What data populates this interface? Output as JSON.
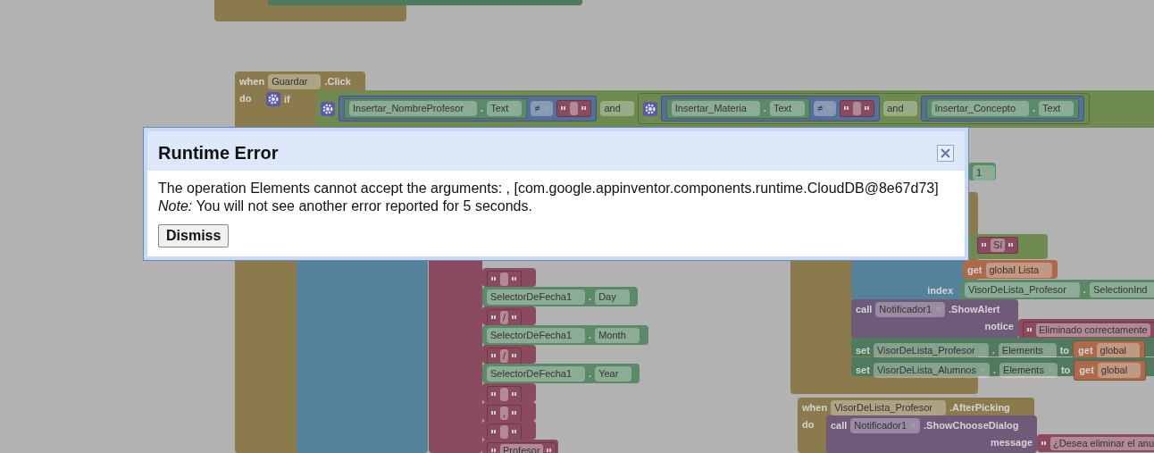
{
  "workspace": {
    "blocks": [
      {
        "color": "#8b7b4c"
      },
      {
        "color": "#4f7a5e"
      },
      {
        "color": "#8b7b4c",
        "lines": [
          [
            {
              "kind": "label",
              "text": "when"
            },
            {
              "kind": "dropdown",
              "text": "Guardar"
            },
            {
              "kind": "label",
              "text": ".Click"
            }
          ],
          [
            {
              "kind": "label",
              "text": "do"
            }
          ]
        ]
      },
      {
        "color": "#8b7b4c",
        "lines": [
          [
            {
              "kind": "gear"
            },
            {
              "kind": "label",
              "text": "if"
            }
          ]
        ]
      },
      {
        "color": "#56819b"
      },
      {
        "color": "#8a4a5f"
      },
      {
        "color": "#6e8a50",
        "lines": [
          [
            {
              "kind": "gear"
            },
            {
              "kind": "block",
              "color": "#566f97",
              "parts": [
                {
                  "kind": "block",
                  "color": "#5b8a68",
                  "parts": [
                    {
                      "kind": "dropdown",
                      "text": "Insertar_NombreProfesor"
                    },
                    {
                      "kind": "label",
                      "text": "."
                    },
                    {
                      "kind": "dropdown",
                      "text": "Text"
                    }
                  ]
                },
                {
                  "kind": "dropdown",
                  "text": "≠"
                },
                {
                  "kind": "empty"
                }
              ]
            },
            {
              "kind": "dropdown",
              "text": "and"
            },
            {
              "kind": "block",
              "parts": [
                {
                  "kind": "gear"
                },
                {
                  "kind": "block",
                  "color": "#566f97",
                  "parts": [
                    {
                      "kind": "block",
                      "color": "#5b8a68",
                      "parts": [
                        {
                          "kind": "dropdown",
                          "text": "Insertar_Materia"
                        },
                        {
                          "kind": "label",
                          "text": "."
                        },
                        {
                          "kind": "dropdown",
                          "text": "Text"
                        }
                      ]
                    },
                    {
                      "kind": "dropdown",
                      "text": "≠"
                    },
                    {
                      "kind": "empty"
                    }
                  ]
                },
                {
                  "kind": "dropdown",
                  "text": "and"
                },
                {
                  "kind": "block",
                  "color": "#566f97",
                  "parts": [
                    {
                      "kind": "block",
                      "color": "#5b8a68",
                      "parts": [
                        {
                          "kind": "dropdown",
                          "text": "Insertar_Concepto"
                        },
                        {
                          "kind": "label",
                          "text": "."
                        },
                        {
                          "kind": "dropdown",
                          "text": "Text"
                        }
                      ]
                    }
                  ]
                }
              ]
            }
          ]
        ]
      },
      {
        "color": "#8a4a5f",
        "lines": [
          [
            {
              "kind": "empty"
            }
          ]
        ]
      },
      {
        "color": "#5b8a68",
        "lines": [
          [
            {
              "kind": "dropdown",
              "text": "SelectorDeFecha1"
            },
            {
              "kind": "label",
              "text": "."
            },
            {
              "kind": "dropdown",
              "text": "Day"
            }
          ]
        ]
      },
      {
        "color": "#8a4a5f",
        "lines": [
          [
            {
              "kind": "string",
              "text": "/"
            }
          ]
        ]
      },
      {
        "color": "#5b8a68",
        "lines": [
          [
            {
              "kind": "dropdown",
              "text": "SelectorDeFecha1"
            },
            {
              "kind": "label",
              "text": "."
            },
            {
              "kind": "dropdown",
              "text": "Month"
            }
          ]
        ]
      },
      {
        "color": "#8a4a5f",
        "lines": [
          [
            {
              "kind": "string",
              "text": "/"
            }
          ]
        ]
      },
      {
        "color": "#5b8a68",
        "lines": [
          [
            {
              "kind": "dropdown",
              "text": "SelectorDeFecha1"
            },
            {
              "kind": "label",
              "text": "."
            },
            {
              "kind": "dropdown",
              "text": "Year"
            }
          ]
        ]
      },
      {
        "color": "#8a4a5f",
        "lines": [
          [
            {
              "kind": "empty"
            }
          ]
        ]
      },
      {
        "color": "#8a4a5f",
        "lines": [
          [
            {
              "kind": "string",
              "text": ","
            }
          ]
        ]
      },
      {
        "color": "#8a4a5f",
        "lines": [
          [
            {
              "kind": "empty"
            }
          ]
        ]
      },
      {
        "color": "#8a4a5f",
        "lines": [
          [
            {
              "kind": "string",
              "text": "Profesor"
            }
          ]
        ]
      },
      {
        "color": "#8b7b4c"
      },
      {
        "color": "#5b8a68",
        "lines": [
          [
            {
              "kind": "dropdown",
              "text": "1"
            }
          ]
        ]
      },
      {
        "color": "#6e8a50",
        "lines": [
          [
            {
              "kind": "string",
              "text": "Sí"
            }
          ]
        ]
      },
      {
        "color": "#56819b",
        "lines": [
          [
            {
              "kind": "label",
              "text": "index"
            }
          ]
        ]
      },
      {
        "color": "#ad6a4b",
        "lines": [
          [
            {
              "kind": "label",
              "text": "get"
            },
            {
              "kind": "dropdown",
              "text": "global Lista"
            }
          ]
        ]
      },
      {
        "color": "#5b8a68",
        "lines": [
          [
            {
              "kind": "dropdown",
              "text": "VisorDeLista_Profesor"
            },
            {
              "kind": "label",
              "text": "."
            },
            {
              "kind": "dropdown",
              "text": "SelectionInd"
            }
          ]
        ]
      },
      {
        "color": "#6f5a7a",
        "lines": [
          [
            {
              "kind": "label",
              "text": "call"
            },
            {
              "kind": "dropdown",
              "text": "Notificador1"
            },
            {
              "kind": "label",
              "text": ".ShowAlert"
            }
          ],
          [
            {
              "kind": "label",
              "text": "notice"
            }
          ]
        ]
      },
      {
        "color": "#8a4a5f",
        "lines": [
          [
            {
              "kind": "string",
              "text": "Eliminado correctamente",
              "clipped": true
            }
          ]
        ]
      },
      {
        "color": "#4f7a5e",
        "lines": [
          [
            {
              "kind": "label",
              "text": "set"
            },
            {
              "kind": "dropdown",
              "text": "VisorDeLista_Profesor"
            },
            {
              "kind": "label",
              "text": "."
            },
            {
              "kind": "dropdown",
              "text": "Elements"
            },
            {
              "kind": "label",
              "text": "to"
            },
            {
              "kind": "block",
              "color": "#ad6a4b",
              "parts": [
                {
                  "kind": "label",
                  "text": "get"
                },
                {
                  "kind": "dropdown",
                  "text": "global"
                }
              ]
            }
          ]
        ]
      },
      {
        "color": "#4f7a5e",
        "lines": [
          [
            {
              "kind": "label",
              "text": "set"
            },
            {
              "kind": "dropdown",
              "text": "VisorDeLista_Alumnos"
            },
            {
              "kind": "label",
              "text": "."
            },
            {
              "kind": "dropdown",
              "text": "Elements"
            },
            {
              "kind": "label",
              "text": "to"
            },
            {
              "kind": "block",
              "color": "#ad6a4b",
              "parts": [
                {
                  "kind": "label",
                  "text": "get"
                },
                {
                  "kind": "dropdown",
                  "text": "global"
                }
              ]
            }
          ]
        ]
      },
      {
        "color": "#8b7b4c",
        "lines": [
          [
            {
              "kind": "label",
              "text": "when"
            },
            {
              "kind": "dropdown",
              "text": "VisorDeLista_Profesor"
            },
            {
              "kind": "label",
              "text": ".AfterPicking"
            }
          ],
          [
            {
              "kind": "label",
              "text": "do"
            }
          ]
        ]
      },
      {
        "color": "#6f5a7a",
        "lines": [
          [
            {
              "kind": "label",
              "text": "call"
            },
            {
              "kind": "dropdown",
              "text": "Notificador1"
            },
            {
              "kind": "label",
              "text": ".ShowChooseDialog"
            }
          ],
          [
            {
              "kind": "label",
              "text": "message"
            }
          ]
        ]
      },
      {
        "color": "#8a4a5f",
        "lines": [
          [
            {
              "kind": "string",
              "text": "¿Desea eliminar el anu",
              "clipped": true
            }
          ]
        ]
      }
    ]
  },
  "dialog": {
    "title": "Runtime Error",
    "message": "The operation Elements cannot accept the arguments: , [com.google.appinventor.components.runtime.CloudDB@8e67d73]",
    "note": "*Note:* You will not see another error reported for 5 seconds.",
    "button": "Dismiss"
  }
}
